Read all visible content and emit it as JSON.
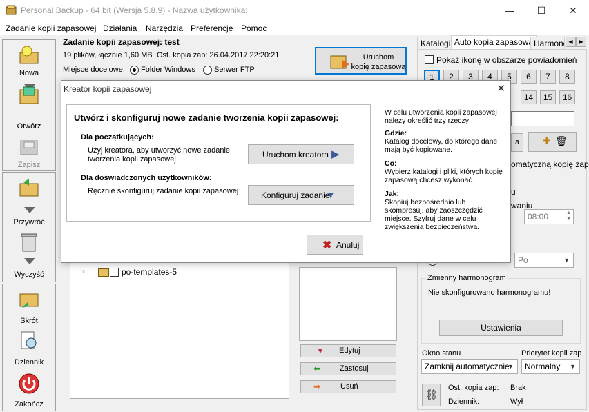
{
  "window": {
    "title": "Personal Backup - 64 bit (Wersja 5.8.9) - Nazwa użytkownika:",
    "minimize": "—",
    "maximize": "☐",
    "close": "✕"
  },
  "menu": [
    "Zadanie kopii zapasowej",
    "Działania",
    "Narzędzia",
    "Preferencje",
    "Pomoc"
  ],
  "toolbar": {
    "new": "Nowa",
    "open": "Otwórz",
    "save": "Zapisz",
    "restore": "Przywróć",
    "clean": "Wyczyść",
    "shortcut": "Skrót",
    "log": "Dziennik",
    "exit": "Zakończ"
  },
  "task": {
    "heading": "Zadanie kopii zapasowej: test",
    "files_info": "19 plików, łącznie 1,60 MB",
    "last_backup": "Ost. kopia zap: 26.04.2017 22:20:21",
    "destination_label": "Miejsce docelowe:",
    "dest_folder": "Folder Windows",
    "dest_ftp": "Serwer FTP",
    "run_line1": "Uruchom",
    "run_line2": "kopię zapasową"
  },
  "tree": {
    "item": "po-templates-5"
  },
  "side_buttons": {
    "edit": "Edytuj",
    "apply": "Zastosuj",
    "delete": "Usuń"
  },
  "tabs": [
    "Katalogi",
    "Auto kopia zapasowa",
    "Harmonog"
  ],
  "auto": {
    "tray_checkbox": "Pokaż ikonę w obszarze powiadomień",
    "numbers_row1": [
      "1",
      "2",
      "3",
      "4",
      "5",
      "6",
      "7",
      "8"
    ],
    "numbers_row2": [
      "14",
      "15",
      "16"
    ],
    "auto_backup_partial": "omatyczną kopię zap",
    "partial_u": "u",
    "partial_waniu": "waniu",
    "time_value": "08:00",
    "po_value": "Po",
    "schedule_title": "Zmienny harmonogram",
    "schedule_text": "Nie skonfigurowano harmonogramu!",
    "settings_button": "Ustawienia",
    "status_window_label": "Okno stanu",
    "status_window_value": "Zamknij automatycznie",
    "priority_label": "Priorytet kopii zap",
    "priority_value": "Normalny",
    "last_label": "Ost. kopia zap:",
    "last_value": "Brak",
    "log_label": "Dziennik:",
    "log_value": "Wył"
  },
  "dialog": {
    "title": "Kreator kopii zapasowej",
    "heading": "Utwórz i skonfiguruj nowe zadanie tworzenia kopii zapasowej:",
    "beginners_title": "Dla początkujących:",
    "beginners_text": "Użyj kreatora, aby utworzyć nowe zadanie tworzenia kopii zapasowej",
    "wizard_button": "Uruchom kreatora",
    "advanced_title": "Dla doświadczonych użytkowników:",
    "advanced_text": "Ręcznie skonfiguruj zadanie kopii zapasowej",
    "configure_button": "Konfiguruj zadanie",
    "cancel_button": "Anuluj",
    "help_intro": "W celu utworzenia kopii zapasowej należy określić trzy rzeczy:",
    "where_title": "Gdzie:",
    "where_text": "Katalog docelowy, do którego dane mają być kopiowane.",
    "what_title": "Co:",
    "what_text": "Wybierz katalogi i pliki, których kopię zapasową chcesz wykonać.",
    "how_title": "Jak:",
    "how_text": "Skopiuj bezpośrednio lub skompresuj, aby zaoszczędzić miejsce. Szyfruj dane w celu zwiększenia bezpieczeństwa."
  },
  "colors": {
    "accent": "#0078d7",
    "dialog_bg": "#ffffff",
    "window_bg": "#f0f0f0"
  }
}
